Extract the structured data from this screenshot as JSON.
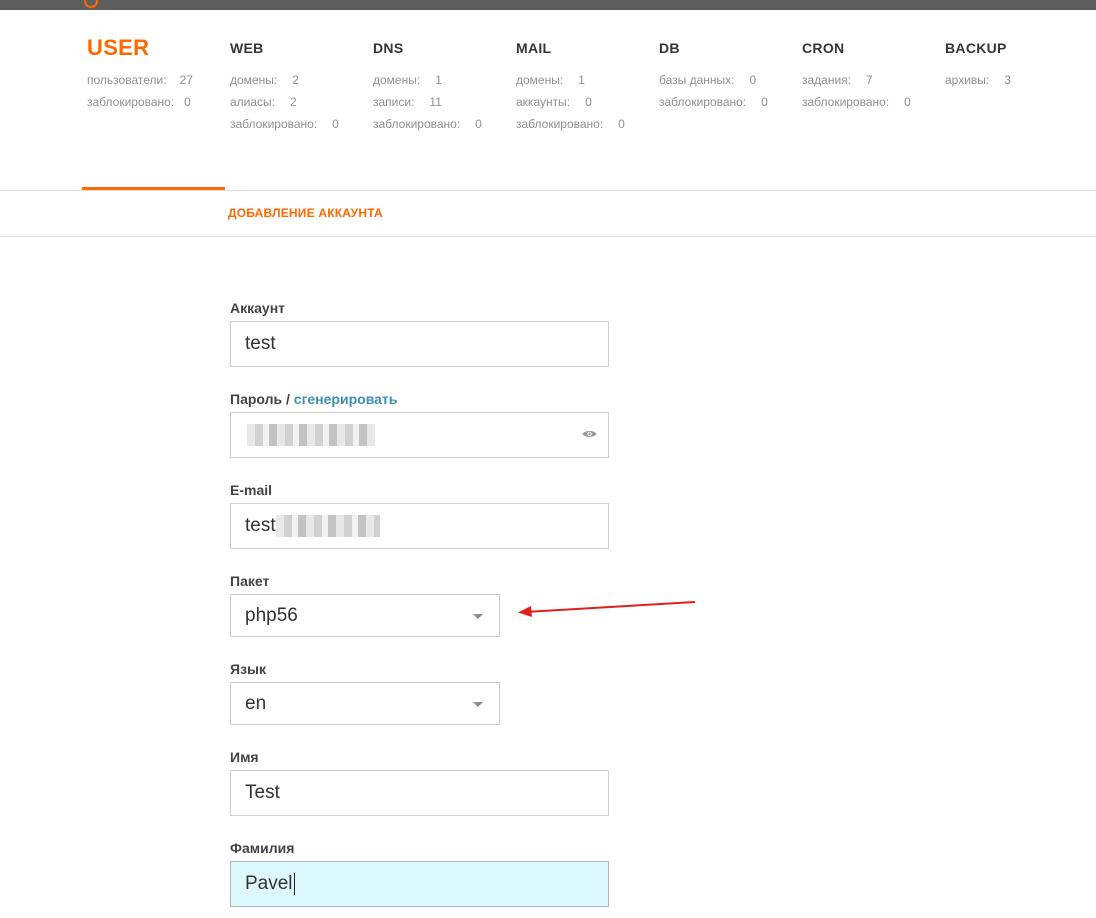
{
  "tabs": [
    {
      "title": "USER",
      "active": true,
      "stats": [
        {
          "label": "пользователи:",
          "value": "27"
        },
        {
          "label": "заблокировано:",
          "value": "0"
        }
      ]
    },
    {
      "title": "WEB",
      "active": false,
      "stats": [
        {
          "label": "домены:",
          "value": "2"
        },
        {
          "label": "алиасы:",
          "value": "2"
        },
        {
          "label": "заблокировано:",
          "value": "0"
        }
      ]
    },
    {
      "title": "DNS",
      "active": false,
      "stats": [
        {
          "label": "домены:",
          "value": "1"
        },
        {
          "label": "записи:",
          "value": "11"
        },
        {
          "label": "заблокировано:",
          "value": "0"
        }
      ]
    },
    {
      "title": "MAIL",
      "active": false,
      "stats": [
        {
          "label": "домены:",
          "value": "1"
        },
        {
          "label": "аккаунты:",
          "value": "0"
        },
        {
          "label": "заблокировано:",
          "value": "0"
        }
      ]
    },
    {
      "title": "DB",
      "active": false,
      "stats": [
        {
          "label": "базы данных:",
          "value": "0"
        },
        {
          "label": "заблокировано:",
          "value": "0"
        }
      ]
    },
    {
      "title": "CRON",
      "active": false,
      "stats": [
        {
          "label": "задания:",
          "value": "7"
        },
        {
          "label": "заблокировано:",
          "value": "0"
        }
      ]
    },
    {
      "title": "BACKUP",
      "active": false,
      "stats": [
        {
          "label": "архивы:",
          "value": "3"
        }
      ]
    }
  ],
  "subtab": {
    "label": "ДОБАВЛЕНИЕ АККАУНТА"
  },
  "form": {
    "account": {
      "label": "Аккаунт",
      "value": "test"
    },
    "password": {
      "label": "Пароль / ",
      "generate_link": "сгенерировать"
    },
    "email": {
      "label": "E-mail",
      "value_prefix": "test"
    },
    "package": {
      "label": "Пакет",
      "value": "php56"
    },
    "language": {
      "label": "Язык",
      "value": "en"
    },
    "first_name": {
      "label": "Имя",
      "value": "Test"
    },
    "last_name": {
      "label": "Фамилия",
      "value": "Pavel"
    }
  },
  "colors": {
    "accent": "#ff6701",
    "link": "#3f8fb4",
    "focused_input_bg": "#dcf8fd",
    "annotation_arrow": "#e0201b"
  },
  "icons": {
    "password_toggle": "eye-icon",
    "select_caret": "chevron-down-icon",
    "annotation": "red-arrow"
  }
}
